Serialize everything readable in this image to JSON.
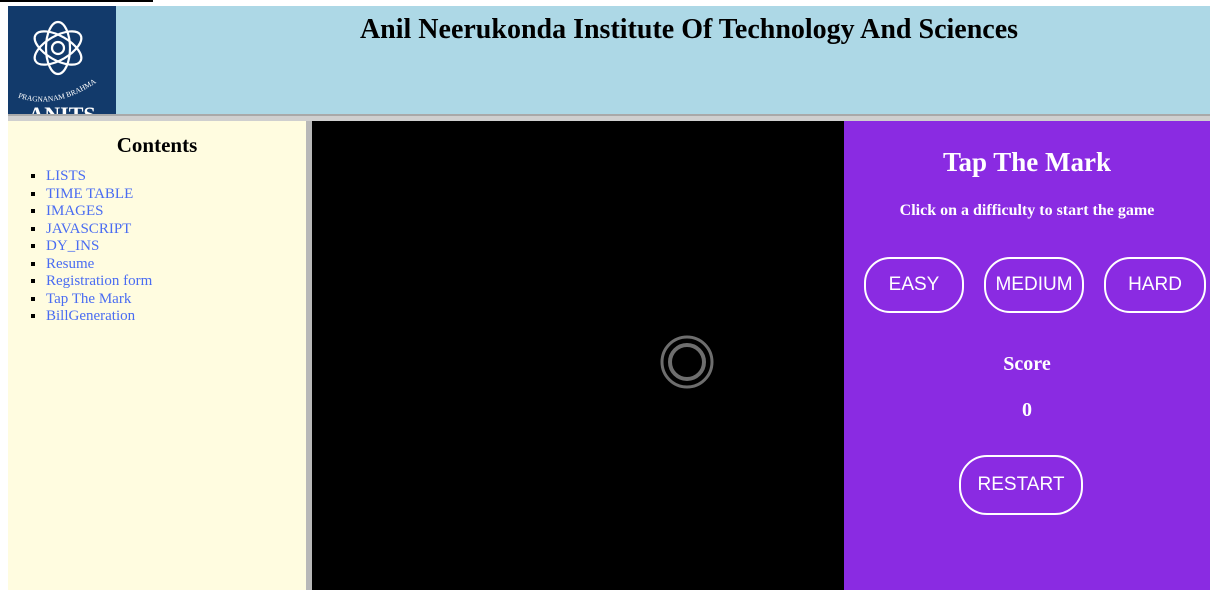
{
  "header": {
    "title": "Anil Neerukonda Institute Of Technology And Sciences",
    "logo_text": "PRAGNANAM BRAHMA",
    "logo_letters": "ANITS"
  },
  "sidebar": {
    "title": "Contents",
    "items": [
      {
        "label": "LISTS"
      },
      {
        "label": "TIME TABLE"
      },
      {
        "label": "IMAGES"
      },
      {
        "label": "JAVASCRIPT"
      },
      {
        "label": "DY_INS"
      },
      {
        "label": "Resume"
      },
      {
        "label": "Registration form"
      },
      {
        "label": "Tap The Mark"
      },
      {
        "label": "BillGeneration"
      }
    ]
  },
  "game": {
    "title": "Tap The Mark",
    "subtitle": "Click on a difficulty to start the game",
    "difficulties": {
      "easy": "EASY",
      "medium": "MEDIUM",
      "hard": "HARD"
    },
    "score_label": "Score",
    "score_value": "0",
    "restart_label": "RESTART"
  },
  "colors": {
    "header_bg": "#add8e6",
    "sidebar_bg": "#fffce0",
    "link": "#4a6cf2",
    "game_bg": "#000000",
    "panel_bg": "#8a2be2",
    "target": "#6e6e6e"
  }
}
